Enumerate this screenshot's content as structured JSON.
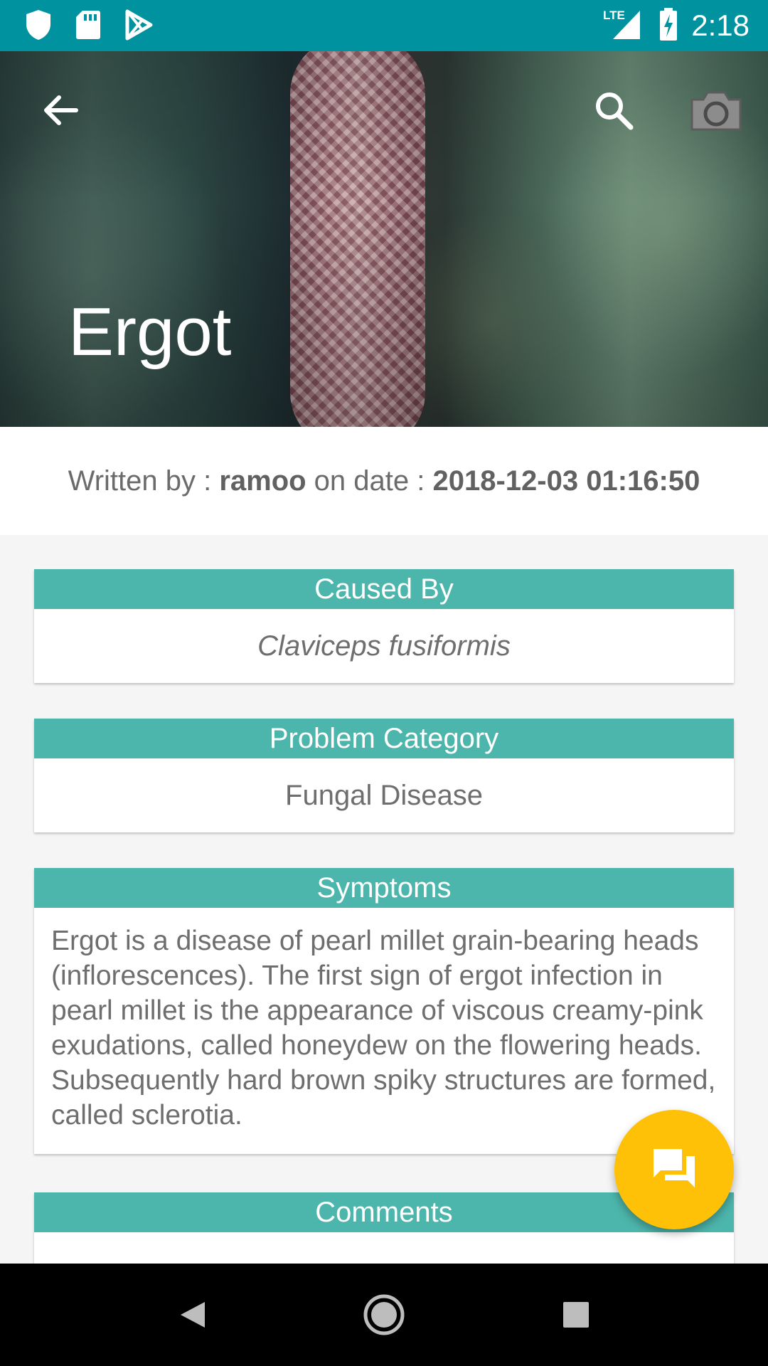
{
  "status_bar": {
    "time": "2:18",
    "network": "LTE",
    "icons": [
      "shield-icon",
      "sd-card-icon",
      "play-store-icon",
      "signal-icon",
      "battery-charging-icon"
    ]
  },
  "header": {
    "title": "Ergot",
    "back_icon": "arrow-back-icon",
    "search_icon": "search-icon",
    "camera_icon": "camera-icon"
  },
  "author": {
    "prefix": "Written by : ",
    "name": "ramoo",
    "date_prefix": " on date : ",
    "date": "2018-12-03 01:16:50"
  },
  "cards": {
    "caused_by": {
      "title": "Caused By",
      "value": "Claviceps fusiformis"
    },
    "problem_category": {
      "title": "Problem Category",
      "value": "Fungal Disease"
    },
    "symptoms": {
      "title": "Symptoms",
      "text": "Ergot is a disease of pearl millet grain-bearing heads (inflorescences). The first sign of ergot infection in pearl millet is the appearance of viscous creamy-pink exudations, called honeydew on the flowering heads. Subsequently hard brown spiky structures are formed, called sclerotia."
    },
    "comments": {
      "title": "Comments"
    }
  },
  "fab": {
    "icon": "chat-icon"
  },
  "nav": {
    "icons": [
      "back-triangle-icon",
      "home-circle-icon",
      "recents-square-icon"
    ]
  },
  "colors": {
    "status_bar": "#00939f",
    "card_header": "#4db6ac",
    "fab": "#ffc107"
  }
}
